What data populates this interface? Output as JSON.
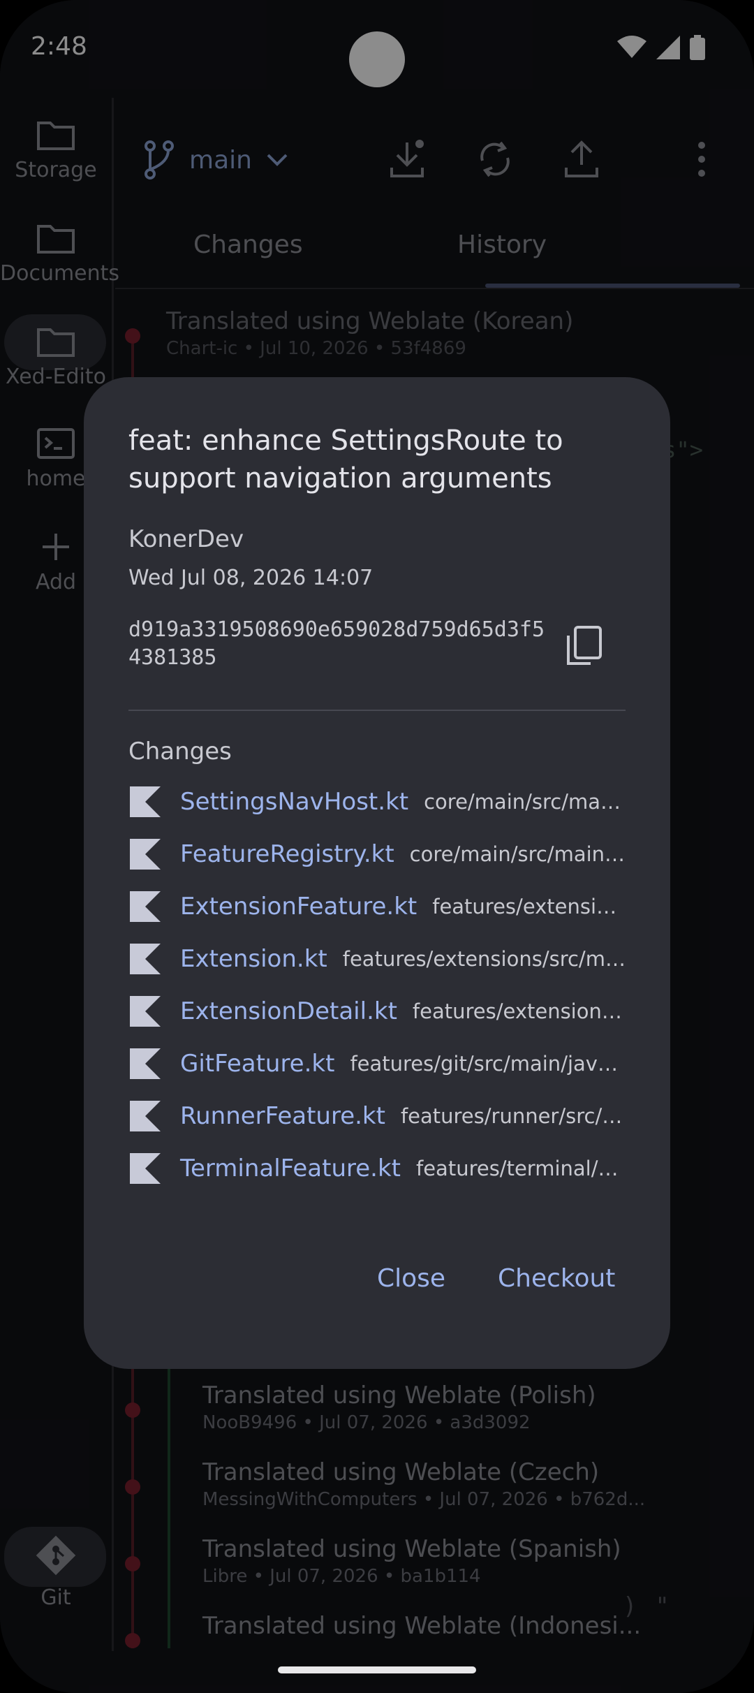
{
  "status": {
    "time": "2:48"
  },
  "rail": {
    "items": [
      {
        "label": "Storage",
        "icon": "folder-icon"
      },
      {
        "label": "Documents",
        "icon": "folder-icon"
      },
      {
        "label": "Xed-Edito",
        "icon": "folder-icon"
      },
      {
        "label": "home",
        "icon": "terminal-icon"
      },
      {
        "label": "Add",
        "icon": "plus-icon"
      }
    ],
    "git_label": "Git"
  },
  "topbar": {
    "branch": "main"
  },
  "tabs": {
    "changes": "Changes",
    "history": "History",
    "active": "History"
  },
  "background_commits": {
    "top": {
      "title": "Translated using Weblate (Korean)",
      "meta": "Chart-ic • Jul 10, 2026 • 53f4869"
    },
    "code_fragment": "ss\">",
    "bottom": [
      {
        "title": "Translated using Weblate (Polish)",
        "meta": "NooB9496 • Jul 07, 2026 • a3d3092"
      },
      {
        "title": "Translated using Weblate (Czech)",
        "meta": "MessingWithComputers • Jul 07, 2026 • b762d..."
      },
      {
        "title": "Translated using Weblate (Spanish)",
        "meta": "Libre • Jul 07, 2026 • ba1b114"
      },
      {
        "title": "Translated using Weblate (Indonesi...",
        "meta": ""
      }
    ],
    "bottom_right_fragment": ")   \""
  },
  "dialog": {
    "title": "feat: enhance SettingsRoute to support navigation arguments",
    "author": "KonerDev",
    "date": "Wed Jul 08, 2026 14:07",
    "hash": "d919a3319508690e659028d759d65d3f54381385",
    "changes_label": "Changes",
    "files": [
      {
        "name": "SettingsNavHost.kt",
        "path": "core/main/src/main/j..."
      },
      {
        "name": "FeatureRegistry.kt",
        "path": "core/main/src/main/j..."
      },
      {
        "name": "ExtensionFeature.kt",
        "path": "features/extensions..."
      },
      {
        "name": "Extension.kt",
        "path": "features/extensions/src/main..."
      },
      {
        "name": "ExtensionDetail.kt",
        "path": "features/extensions/sr..."
      },
      {
        "name": "GitFeature.kt",
        "path": "features/git/src/main/java/..."
      },
      {
        "name": "RunnerFeature.kt",
        "path": "features/runner/src/m..."
      },
      {
        "name": "TerminalFeature.kt",
        "path": "features/terminal/sr..."
      }
    ],
    "close_label": "Close",
    "checkout_label": "Checkout"
  },
  "colors": {
    "accent": "#9db4ec",
    "dialog_bg": "#2c2d34",
    "app_bg": "#121317"
  }
}
